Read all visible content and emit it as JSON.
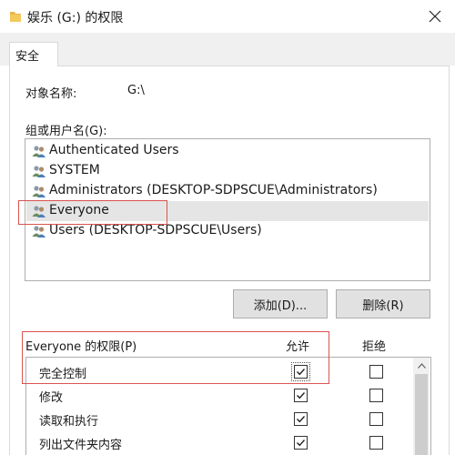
{
  "window": {
    "title": "娱乐 (G:) 的权限",
    "icon": "folder-icon",
    "close_icon": "close-icon"
  },
  "tabs": [
    {
      "label": "安全",
      "active": true
    }
  ],
  "object": {
    "label": "对象名称:",
    "value": "G:\\"
  },
  "groups": {
    "label": "组或用户名(G):",
    "items": [
      {
        "name": "Authenticated Users",
        "icon": "users-icon",
        "selected": false
      },
      {
        "name": "SYSTEM",
        "icon": "users-icon",
        "selected": false
      },
      {
        "name": "Administrators (DESKTOP-SDPSCUE\\Administrators)",
        "icon": "users-icon",
        "selected": false
      },
      {
        "name": "Everyone",
        "icon": "users-icon",
        "selected": true
      },
      {
        "name": "Users (DESKTOP-SDPSCUE\\Users)",
        "icon": "users-icon",
        "selected": false
      }
    ]
  },
  "buttons": {
    "add": "添加(D)...",
    "remove": "删除(R)"
  },
  "permissions": {
    "header": "Everyone 的权限(P)",
    "allow_header": "允许",
    "deny_header": "拒绝",
    "items": [
      {
        "name": "完全控制",
        "allow": true,
        "deny": false
      },
      {
        "name": "修改",
        "allow": true,
        "deny": false
      },
      {
        "name": "读取和执行",
        "allow": true,
        "deny": false
      },
      {
        "name": "列出文件夹内容",
        "allow": true,
        "deny": false
      }
    ]
  },
  "colors": {
    "highlight_border": "#d9534f",
    "selection": "#e5e5e5"
  }
}
